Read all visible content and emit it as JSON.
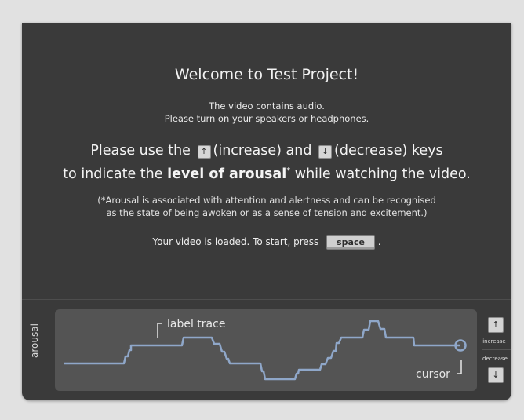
{
  "welcome": "Welcome to Test Project!",
  "audio": {
    "line1": "The video contains audio.",
    "line2": "Please turn on your speakers or headphones."
  },
  "instruction": {
    "part1": "Please use the",
    "increase_text": "(increase) and",
    "decrease_text": "(decrease) keys",
    "part2_pre": "to indicate the",
    "level": "level of arousal",
    "asterisk": "*",
    "part2_post": "while watching the video."
  },
  "note": {
    "line1": "(*Arousal is associated with attention and alertness and can be recognised",
    "line2": "as the state of being awoken or as a sense of tension and excitement.)"
  },
  "start": {
    "text": "Your video is loaded. To start, press",
    "key": "space",
    "end": "."
  },
  "trace": {
    "axis_label": "arousal",
    "label_annotation": "label trace",
    "cursor_annotation": "cursor"
  },
  "controls": {
    "increase_label": "increase",
    "decrease_label": "decrease",
    "up_icon": "↑",
    "down_icon": "↓"
  },
  "colors": {
    "trace": "#8fa7c9",
    "panel": "#3a3a3a",
    "background": "#e1e1e1"
  }
}
